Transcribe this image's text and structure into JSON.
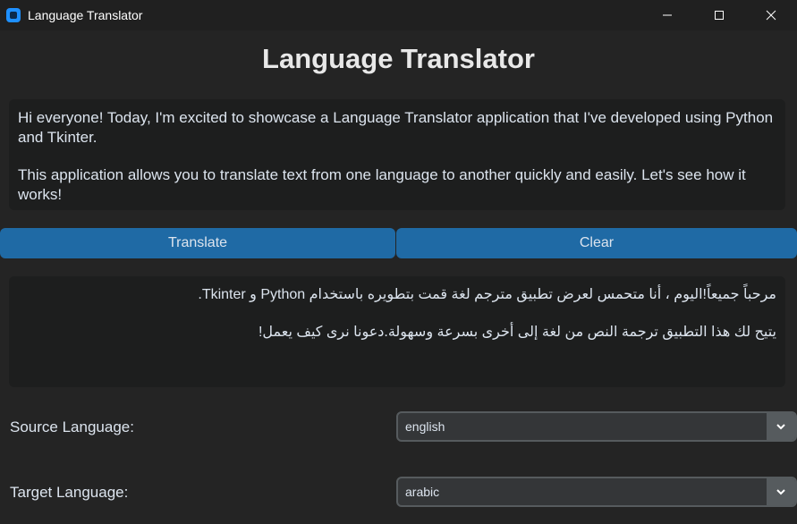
{
  "window": {
    "title": "Language Translator",
    "controls": [
      "minimize-icon",
      "maximize-icon",
      "close-icon"
    ]
  },
  "header": {
    "title": "Language Translator"
  },
  "input": {
    "paragraphs": [
      "Hi everyone! Today, I'm excited to showcase a Language Translator application that I've developed using Python and Tkinter.",
      "This application allows you to translate text from one language to another quickly and easily. Let's see how it works!"
    ]
  },
  "buttons": {
    "translate_label": "Translate",
    "clear_label": "Clear"
  },
  "output": {
    "paragraphs": [
      "مرحباً جميعاً!اليوم ، أنا متحمس لعرض تطبيق مترجم لغة قمت بتطويره باستخدام Python و Tkinter.",
      "يتيح لك هذا التطبيق ترجمة النص من لغة إلى أخرى بسرعة وسهولة.دعونا نرى كيف يعمل!"
    ]
  },
  "source": {
    "label": "Source Language:",
    "value": "english"
  },
  "target": {
    "label": "Target Language:",
    "value": "arabic"
  },
  "colors": {
    "background": "#242424",
    "titlebar": "#202020",
    "textbox": "#1d1e1e",
    "accent": "#1f6aa5",
    "dropdown": "#343638",
    "dropdown_button": "#565b5e"
  }
}
